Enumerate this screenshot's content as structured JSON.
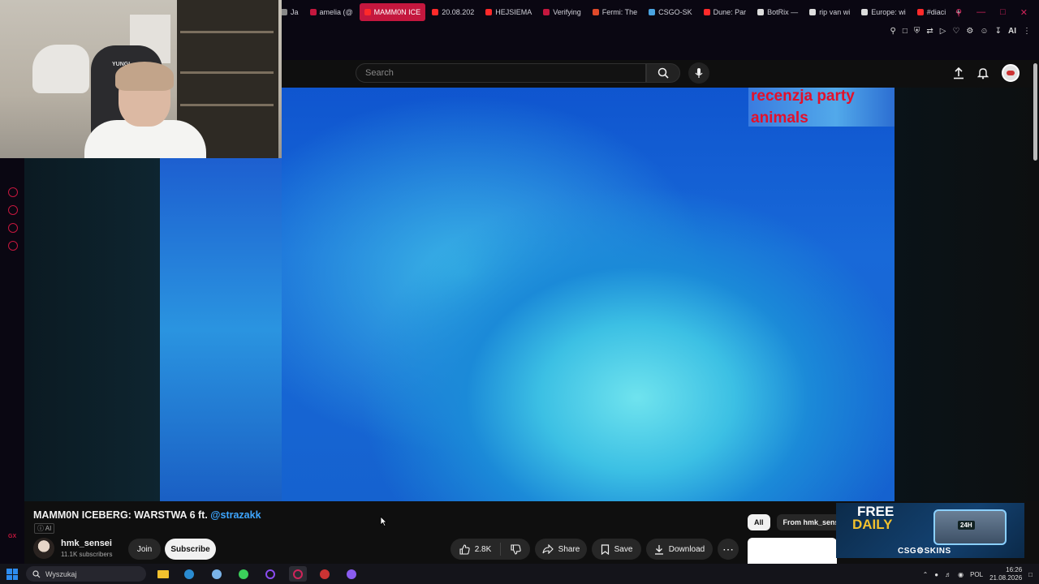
{
  "browser": {
    "tabs": [
      {
        "label": "Ja",
        "color": "#888888"
      },
      {
        "label": "amelia (@",
        "color": "#c4173e"
      },
      {
        "label": "MAMM0N ICE",
        "color": "#ff2a2a",
        "active": true
      },
      {
        "label": "20.08.202",
        "color": "#ff2a2a"
      },
      {
        "label": "HEJSIEMA",
        "color": "#ff2a2a"
      },
      {
        "label": "Verifying",
        "color": "#c4173e"
      },
      {
        "label": "Fermi: The",
        "color": "#e04a2a"
      },
      {
        "label": "CSGO-SK",
        "color": "#4aa3e0"
      },
      {
        "label": "Dune: Par",
        "color": "#ff2a2a"
      },
      {
        "label": "BotRix —",
        "color": "#dddddd"
      },
      {
        "label": "rip van wi",
        "color": "#dddddd"
      },
      {
        "label": "Europe: wi",
        "color": "#dddddd"
      },
      {
        "label": "#diaci",
        "color": "#ff2a2a"
      }
    ],
    "new_tab": "+",
    "toolbar_ai": "AI"
  },
  "youtube": {
    "search_placeholder": "Search",
    "video": {
      "title": "MAMM0N ICEBERG: WARSTWA 6 ft.",
      "mention": "@strazakk",
      "ai_label": "AI",
      "overlay_line1": "recenzja party",
      "overlay_line2": "animals"
    },
    "channel": {
      "name": "hmk_sensei",
      "subscribers": "11.1K subscribers",
      "join": "Join",
      "subscribe": "Subscribe"
    },
    "actions": {
      "likes": "2.8K",
      "share": "Share",
      "save": "Save",
      "download": "Download"
    },
    "chips": {
      "all": "All",
      "from": "From hmk_sense"
    }
  },
  "ad": {
    "free": "FREE",
    "daily": "DAILY",
    "tag": "24H",
    "brand": "CSG⚙SKINS"
  },
  "webcam": {
    "chair_logo": "YUNGI"
  },
  "sidebar": {
    "gx": "GX"
  },
  "taskbar": {
    "search": "Wyszukaj",
    "lang": "POL",
    "time": "16:26",
    "date": "21.08.2026"
  }
}
